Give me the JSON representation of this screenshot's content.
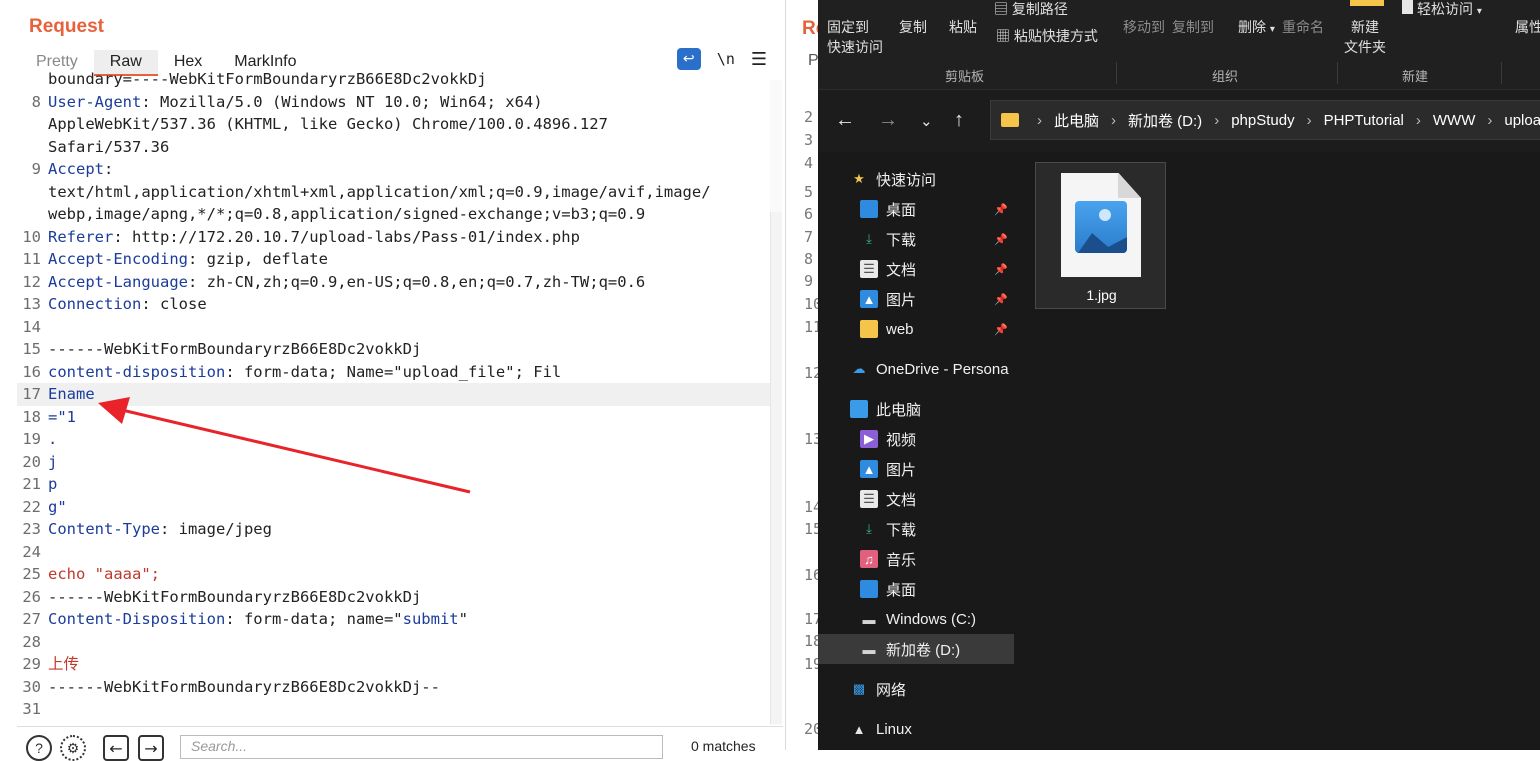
{
  "burp": {
    "title": "Request",
    "tabs": [
      "Pretty",
      "Raw",
      "Hex",
      "MarkInfo"
    ],
    "active_tab": "Raw",
    "toolbar_newline": "\\n",
    "lines": [
      {
        "n": "",
        "segs": [
          [
            "t",
            "boundary=----WebKitFormBoundaryrzB66E8Dc2vokkDj"
          ]
        ]
      },
      {
        "n": "8",
        "segs": [
          [
            "k",
            "User-Agent"
          ],
          [
            "t",
            ": Mozilla/5.0 (Windows NT 10.0; Win64; x64)"
          ]
        ]
      },
      {
        "n": "",
        "segs": [
          [
            "t",
            "AppleWebKit/537.36 (KHTML, like Gecko) Chrome/100.0.4896.127"
          ]
        ]
      },
      {
        "n": "",
        "segs": [
          [
            "t",
            "Safari/537.36"
          ]
        ]
      },
      {
        "n": "9",
        "segs": [
          [
            "k",
            "Accept"
          ],
          [
            "t",
            ":"
          ]
        ]
      },
      {
        "n": "",
        "segs": [
          [
            "t",
            "text/html,application/xhtml+xml,application/xml;q=0.9,image/avif,image/"
          ]
        ]
      },
      {
        "n": "",
        "segs": [
          [
            "t",
            "webp,image/apng,*/*;q=0.8,application/signed-exchange;v=b3;q=0.9"
          ]
        ]
      },
      {
        "n": "10",
        "segs": [
          [
            "k",
            "Referer"
          ],
          [
            "t",
            ": http://172.20.10.7/upload-labs/Pass-01/index.php"
          ]
        ]
      },
      {
        "n": "11",
        "segs": [
          [
            "k",
            "Accept-Encoding"
          ],
          [
            "t",
            ": gzip, deflate"
          ]
        ]
      },
      {
        "n": "12",
        "segs": [
          [
            "k",
            "Accept-Language"
          ],
          [
            "t",
            ": zh-CN,zh;q=0.9,en-US;q=0.8,en;q=0.7,zh-TW;q=0.6"
          ]
        ]
      },
      {
        "n": "13",
        "segs": [
          [
            "k",
            "Connection"
          ],
          [
            "t",
            ": close"
          ]
        ]
      },
      {
        "n": "14",
        "segs": []
      },
      {
        "n": "15",
        "segs": [
          [
            "t",
            "------WebKitFormBoundaryrzB66E8Dc2vokkDj"
          ]
        ]
      },
      {
        "n": "16",
        "segs": [
          [
            "k",
            "content-disposition"
          ],
          [
            "t",
            ": form-data; Name=\"upload_file\"; Fil"
          ]
        ]
      },
      {
        "n": "17",
        "hl": true,
        "segs": [
          [
            "k",
            "Ename"
          ]
        ]
      },
      {
        "n": "18",
        "segs": [
          [
            "k",
            "=\"1"
          ]
        ]
      },
      {
        "n": "19",
        "segs": [
          [
            "k",
            "."
          ]
        ]
      },
      {
        "n": "20",
        "segs": [
          [
            "k",
            "j"
          ]
        ]
      },
      {
        "n": "21",
        "segs": [
          [
            "k",
            "p"
          ]
        ]
      },
      {
        "n": "22",
        "segs": [
          [
            "k",
            "g\""
          ]
        ]
      },
      {
        "n": "23",
        "segs": [
          [
            "k",
            "Content-Type"
          ],
          [
            "t",
            ": image/jpeg"
          ]
        ]
      },
      {
        "n": "24",
        "segs": []
      },
      {
        "n": "25",
        "segs": [
          [
            "r",
            "echo \"aaaa\";"
          ]
        ]
      },
      {
        "n": "26",
        "segs": [
          [
            "t",
            "------WebKitFormBoundaryrzB66E8Dc2vokkDj"
          ]
        ]
      },
      {
        "n": "27",
        "segs": [
          [
            "k",
            "Content-Disposition"
          ],
          [
            "t",
            ": form-data; name=\""
          ],
          [
            "s",
            "submit"
          ],
          [
            "t",
            "\""
          ]
        ]
      },
      {
        "n": "28",
        "segs": []
      },
      {
        "n": "29",
        "segs": [
          [
            "r",
            "上传"
          ]
        ]
      },
      {
        "n": "30",
        "segs": [
          [
            "t",
            "------WebKitFormBoundaryrzB66E8Dc2vokkDj--"
          ]
        ]
      },
      {
        "n": "31",
        "segs": []
      }
    ],
    "search_placeholder": "Search...",
    "matches": "0 matches"
  },
  "burp2": {
    "title": "Req",
    "tab": "P",
    "line_numbers": [
      "2",
      "3",
      "4",
      "5",
      "6",
      "7",
      "8",
      "9",
      "10",
      "11",
      "12",
      "13",
      "14",
      "15",
      "16",
      "17",
      "18",
      "19",
      "20"
    ]
  },
  "explorer": {
    "ribbon": {
      "pin_label": "固定到\n快速访问",
      "copy": "复制",
      "paste": "粘贴",
      "copy_path": "复制路径",
      "paste_shortcut": "粘贴快捷方式",
      "move_to": "移动到",
      "copy_to": "复制到",
      "delete": "删除",
      "rename": "重命名",
      "new_folder": "新建\n文件夹",
      "easy_access": "轻松访问",
      "properties": "属性",
      "group_clipboard": "剪贴板",
      "group_organize": "组织",
      "group_new": "新建"
    },
    "breadcrumb": [
      "此电脑",
      "新加卷 (D:)",
      "phpStudy",
      "PHPTutorial",
      "WWW",
      "uploa"
    ],
    "nav": [
      {
        "label": "快速访问",
        "icon": "star-icon",
        "pinned": false,
        "indent": 1
      },
      {
        "label": "桌面",
        "icon": "desktop-icon",
        "pinned": true,
        "indent": 2
      },
      {
        "label": "下载",
        "icon": "download-icon",
        "pinned": true,
        "indent": 2
      },
      {
        "label": "文档",
        "icon": "document-icon",
        "pinned": true,
        "indent": 2
      },
      {
        "label": "图片",
        "icon": "picture-icon",
        "pinned": true,
        "indent": 2
      },
      {
        "label": "web",
        "icon": "folder-icon",
        "pinned": true,
        "indent": 2
      },
      {
        "label": "OneDrive - Persona",
        "icon": "cloud-icon",
        "pinned": false,
        "indent": 1,
        "gap": true
      },
      {
        "label": "此电脑",
        "icon": "computer-icon",
        "pinned": false,
        "indent": 1,
        "gap": true
      },
      {
        "label": "视频",
        "icon": "video-icon",
        "pinned": false,
        "indent": 2
      },
      {
        "label": "图片",
        "icon": "picture-icon",
        "pinned": false,
        "indent": 2
      },
      {
        "label": "文档",
        "icon": "document-icon",
        "pinned": false,
        "indent": 2
      },
      {
        "label": "下载",
        "icon": "download-icon",
        "pinned": false,
        "indent": 2
      },
      {
        "label": "音乐",
        "icon": "music-icon",
        "pinned": false,
        "indent": 2
      },
      {
        "label": "桌面",
        "icon": "desktop-icon",
        "pinned": false,
        "indent": 2
      },
      {
        "label": "Windows (C:)",
        "icon": "drive-icon",
        "pinned": false,
        "indent": 2
      },
      {
        "label": "新加卷 (D:)",
        "icon": "drive-icon",
        "pinned": false,
        "indent": 2,
        "selected": true
      },
      {
        "label": "网络",
        "icon": "network-icon",
        "pinned": false,
        "indent": 1,
        "gap": true
      },
      {
        "label": "Linux",
        "icon": "linux-icon",
        "pinned": false,
        "indent": 1,
        "gap": true
      }
    ],
    "files": [
      {
        "name": "1.jpg",
        "icon": "image-file-icon"
      }
    ]
  },
  "colors": {
    "burp_accent": "#e8613a",
    "syntax_key": "#1b3c9b",
    "syntax_red": "#c0392b",
    "annotation_arrow": "#e8232a",
    "explorer_bg": "#191919"
  }
}
